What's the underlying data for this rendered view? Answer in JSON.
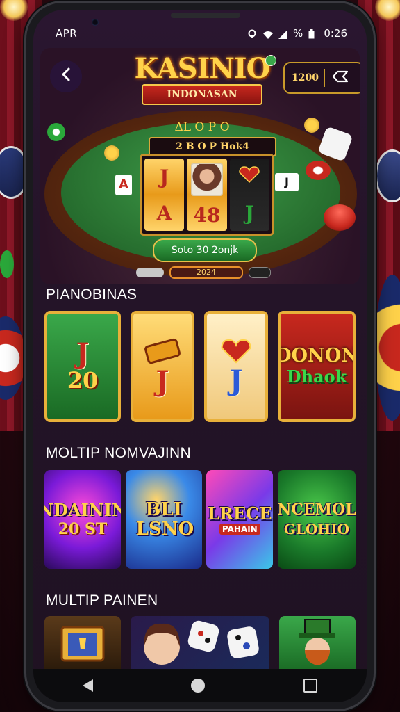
{
  "status_bar": {
    "left_label": "APR",
    "time": "0:26",
    "battery": "%"
  },
  "hero": {
    "logo_title": "KASINIO",
    "logo_ribbon": "INDONASAN",
    "balance_value": "1200",
    "table_title": "ΔL O P O",
    "reel_header": "2 Β O P Hok4",
    "reels": [
      {
        "top": "J",
        "bottom": "A"
      },
      {
        "top": "",
        "bottom": "48"
      },
      {
        "top": "",
        "bottom": "J"
      }
    ],
    "left_card": "A",
    "spin_label": "Soto 30 2onjk",
    "pager_active": "2024"
  },
  "sections": {
    "first": {
      "title": "PIANOBINAS",
      "cards": [
        {
          "top": "J",
          "bottom": "20"
        },
        {
          "top": "",
          "bottom": "J"
        },
        {
          "top": "",
          "bottom": "J"
        },
        {
          "top": "DONON",
          "bottom": "Dhaok"
        }
      ]
    },
    "second": {
      "title": "MOLTIP NOMVAJINN",
      "cards": [
        {
          "title": "NDAININ",
          "sub": "20 ST"
        },
        {
          "title": "BLI LSNO",
          "sub": ""
        },
        {
          "title": "LRECE",
          "sub": "PAHAIN"
        },
        {
          "title": "NCEMOL",
          "sub": "GLOHIO"
        }
      ]
    },
    "third": {
      "title": "MULTIP PAINEN"
    }
  },
  "colors": {
    "accent_gold": "#ffd24a",
    "felt_green": "#2a7432",
    "brand_red": "#c8281e",
    "screen_bg": "#241428"
  },
  "icons": [
    "back-arrow-icon",
    "swap-icon",
    "location-icon",
    "wifi-icon",
    "signal-icon",
    "battery-icon",
    "nav-back-icon",
    "nav-home-icon",
    "nav-recents-icon"
  ]
}
